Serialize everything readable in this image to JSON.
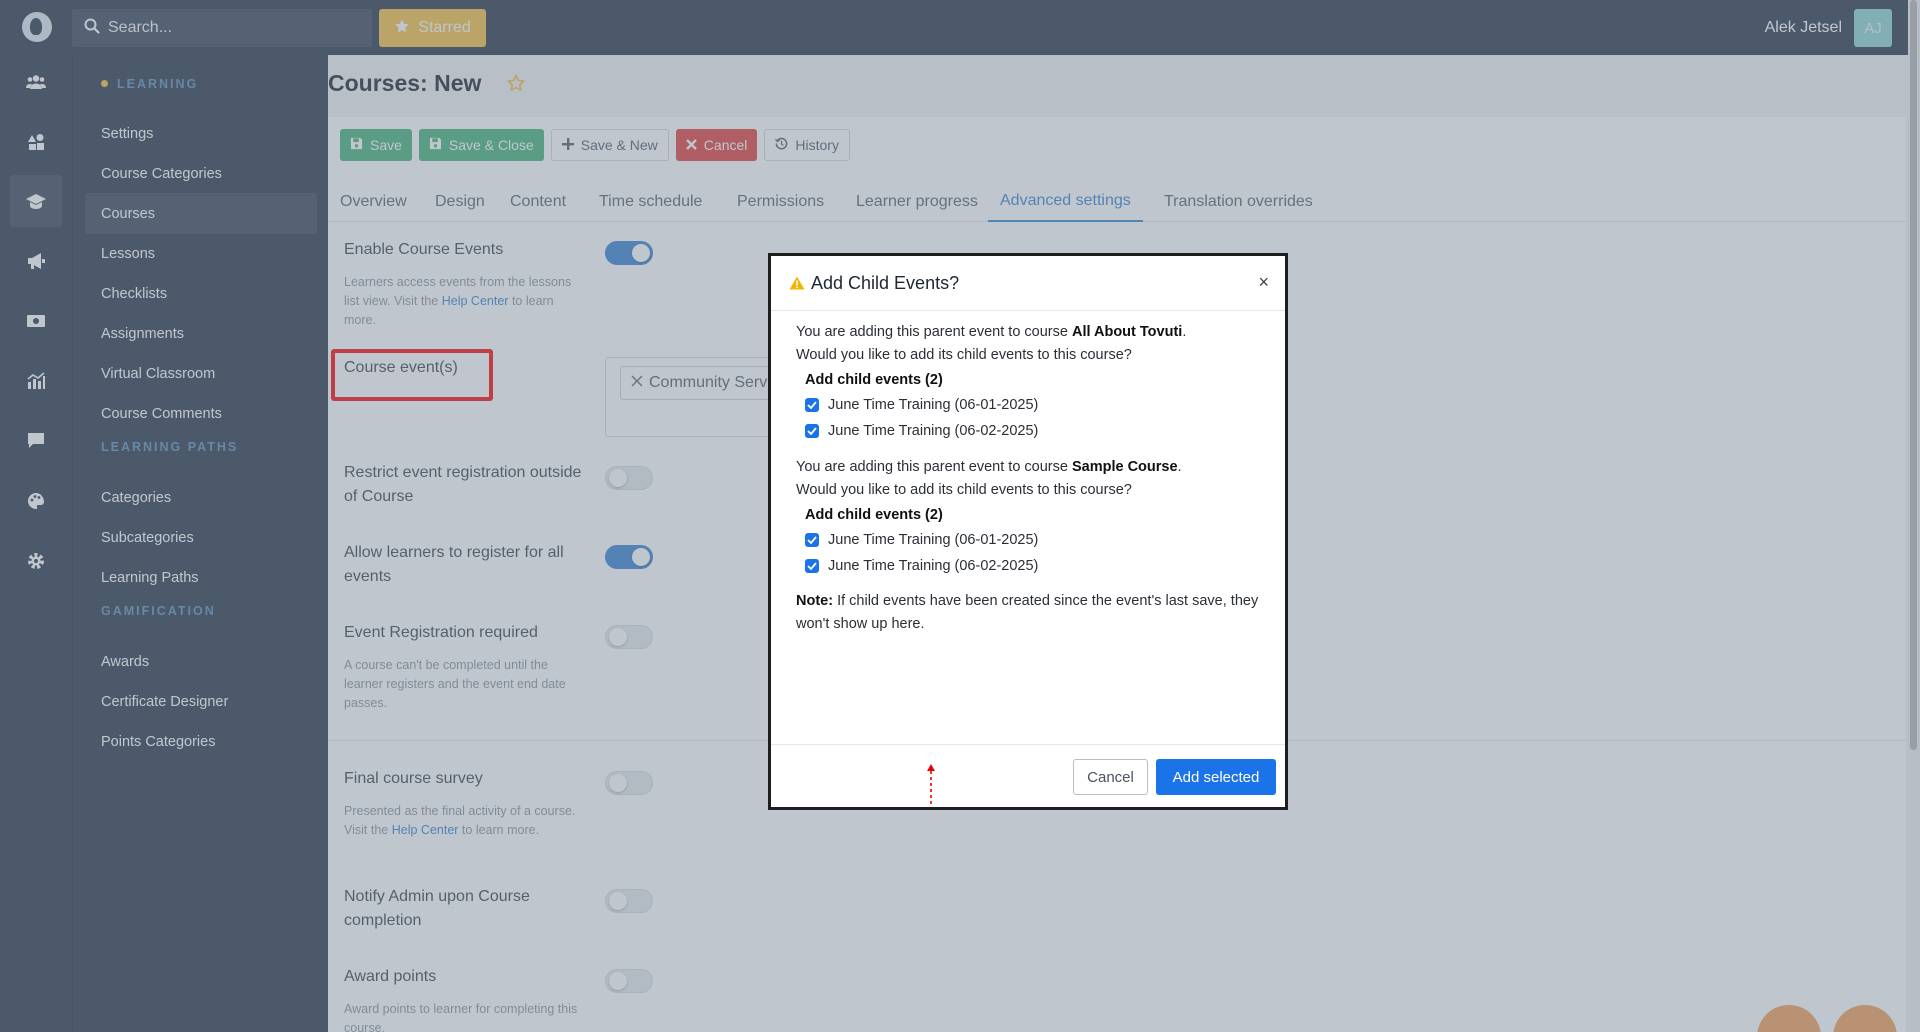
{
  "topbar": {
    "search_placeholder": "Search...",
    "starred_label": "Starred",
    "user_name": "Alek Jetsel",
    "user_initials": "AJ"
  },
  "rail": {
    "icons": [
      "users-icon",
      "shapes-icon",
      "graduation-cap-icon",
      "megaphone-icon",
      "money-icon",
      "chart-icon",
      "chat-icon",
      "palette-icon",
      "gear-icon"
    ],
    "active_index": 2
  },
  "subnav": {
    "sections": [
      {
        "label": "LEARNING",
        "items": [
          "Settings",
          "Course Categories",
          "Courses",
          "Lessons",
          "Checklists",
          "Assignments",
          "Virtual Classroom",
          "Course Comments"
        ]
      },
      {
        "label": "LEARNING PATHS",
        "items": [
          "Categories",
          "Subcategories",
          "Learning Paths"
        ]
      },
      {
        "label": "GAMIFICATION",
        "items": [
          "Awards",
          "Certificate Designer",
          "Points Categories"
        ]
      }
    ],
    "active_item": "Courses"
  },
  "page": {
    "title": "Courses: New",
    "toolbar": {
      "save": "Save",
      "save_close": "Save & Close",
      "save_new": "Save & New",
      "cancel": "Cancel",
      "history": "History"
    },
    "tabs": [
      "Overview",
      "Design",
      "Content",
      "Time schedule",
      "Permissions",
      "Learner progress",
      "Advanced settings",
      "Translation overrides"
    ],
    "active_tab": "Advanced settings"
  },
  "settings": {
    "enable_course_events": {
      "label": "Enable Course Events",
      "help_before": "Learners access events from the lessons list view. Visit the",
      "help_link": "Help Center",
      "help_after": "to learn more.",
      "enabled": true
    },
    "course_events": {
      "label": "Course event(s)",
      "tag": "Community Service"
    },
    "restrict_registration": {
      "label": "Restrict event registration outside of Course",
      "enabled": false
    },
    "allow_register_all": {
      "label": "Allow learners to register for all events",
      "enabled": true
    },
    "registration_required": {
      "label": "Event Registration required",
      "help": "A course can't be completed until the learner registers and the event end date passes.",
      "enabled": false
    },
    "final_survey": {
      "label": "Final course survey",
      "help_before": "Presented as the final activity of a course. Visit the",
      "help_link": "Help Center",
      "help_after": "to learn more.",
      "enabled": false
    },
    "notify_admin": {
      "label": "Notify Admin upon Course completion",
      "enabled": false
    },
    "award_points": {
      "label": "Award points",
      "help": "Award points to learner for completing this course.",
      "enabled": false
    }
  },
  "modal": {
    "title": "Add Child Events?",
    "close_glyph": "×",
    "blocks": [
      {
        "intro_before": "You are adding this parent event to course",
        "course": "All About Tovuti",
        "intro_after": ".",
        "question": "Would you like to add its child events to this course?",
        "group_label": "Add child events (2)",
        "events": [
          "June Time Training (06-01-2025)",
          "June Time Training (06-02-2025)"
        ]
      },
      {
        "intro_before": "You are adding this parent event to course",
        "course": "Sample Course",
        "intro_after": ".",
        "question": "Would you like to add its child events to this course?",
        "group_label": "Add child events (2)",
        "events": [
          "June Time Training (06-01-2025)",
          "June Time Training (06-02-2025)"
        ]
      }
    ],
    "note_label": "Note:",
    "note_text": "If child events have been created since the event's last save, they won't show up here.",
    "cancel_label": "Cancel",
    "add_label": "Add selected"
  },
  "colors": {
    "accent": "#1a73e8",
    "sidebar": "#2c3a4d",
    "starred": "#f5c248",
    "success": "#46b37a",
    "danger": "#e34040",
    "highlight": "#ff0a0a"
  }
}
